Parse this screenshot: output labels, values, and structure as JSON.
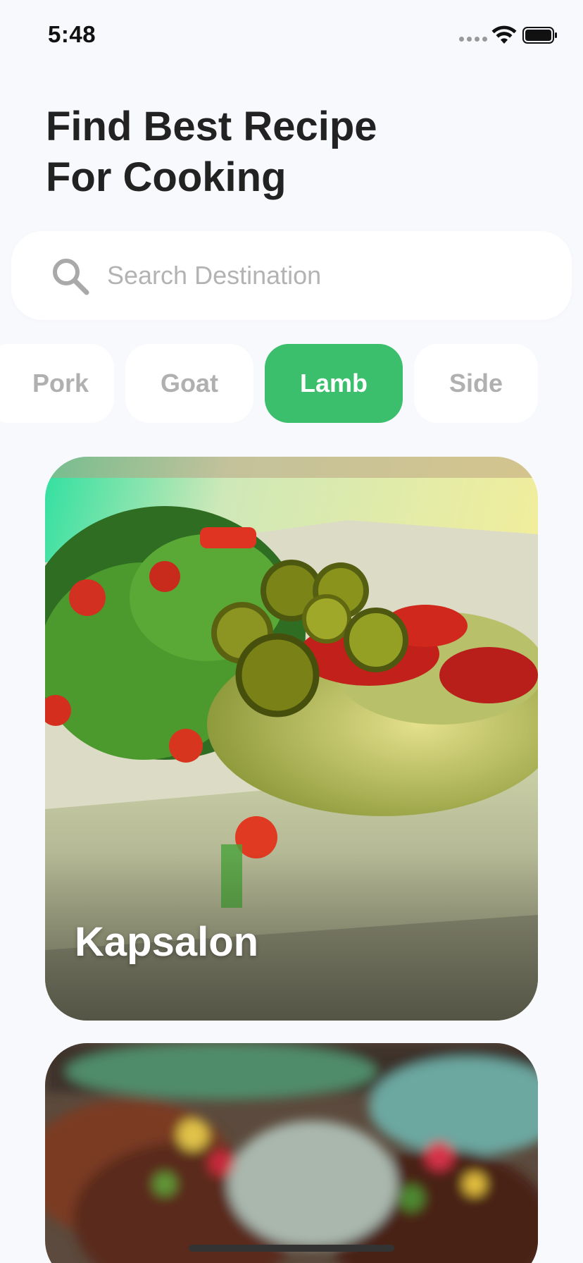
{
  "status_bar": {
    "time": "5:48"
  },
  "header": {
    "title_line1": "Find Best Recipe",
    "title_line2": "For Cooking"
  },
  "search": {
    "placeholder": "Search Destination",
    "value": ""
  },
  "categories": [
    {
      "label": "Pork",
      "active": false
    },
    {
      "label": "Goat",
      "active": false
    },
    {
      "label": "Lamb",
      "active": true
    },
    {
      "label": "Side",
      "active": false
    }
  ],
  "recipes": [
    {
      "name": "Kapsalon"
    },
    {
      "name": ""
    }
  ],
  "colors": {
    "accent": "#3cbf6c",
    "background": "#f7f9fc",
    "chip_inactive_text": "#b0b0b0"
  },
  "icons": {
    "search": "search-icon",
    "wifi": "wifi-icon",
    "battery": "battery-icon",
    "signal": "cellular-signal-icon"
  }
}
